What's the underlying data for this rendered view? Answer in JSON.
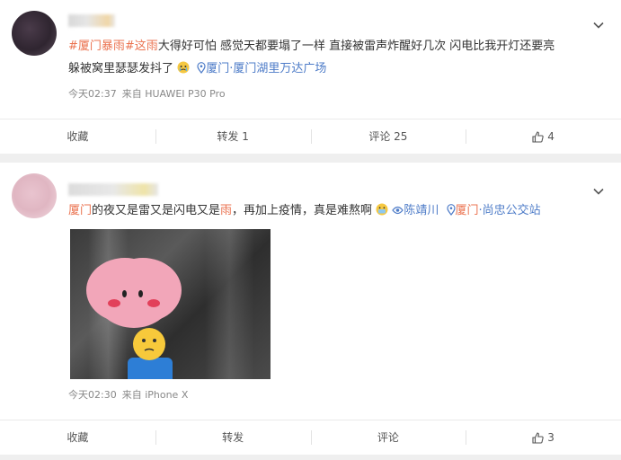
{
  "posts": [
    {
      "text": {
        "tag1": "#厦门暴雨#",
        "tag2": "这雨",
        "line1_rest": "大得好可怕 感觉天都要塌了一样 直接被雷声炸醒好几次 闪电比我开灯还要亮",
        "line2": "躲被窝里瑟瑟发抖了",
        "location_pin": "",
        "location": "厦门·厦门湖里万达广场"
      },
      "time": "今天02:37",
      "source": "来自 HUAWEI P30 Pro",
      "actions": {
        "collect": "收藏",
        "repost": "转发 1",
        "comment": "评论 25",
        "like": "4"
      }
    },
    {
      "text": {
        "kw1": "厦门",
        "mid": "的夜又是雷又是闪电又是",
        "kw2": "雨",
        "rest": "，再加上疫情，真是难熬啊",
        "mention": "陈靖川",
        "location_city": "厦门",
        "location_rest": "·尚忠公交站"
      },
      "time": "今天02:30",
      "source": "来自 iPhone X",
      "actions": {
        "collect": "收藏",
        "repost": "转发",
        "comment": "评论",
        "like": "3"
      }
    }
  ],
  "icons": {
    "chevron": "chevron-down-icon",
    "like": "thumbs-up-icon",
    "location": "location-pin-icon",
    "weibo_user": "weibo-user-icon"
  },
  "colors": {
    "keyword": "#eb7350",
    "link": "#4e7cc8",
    "meta": "#888888"
  }
}
